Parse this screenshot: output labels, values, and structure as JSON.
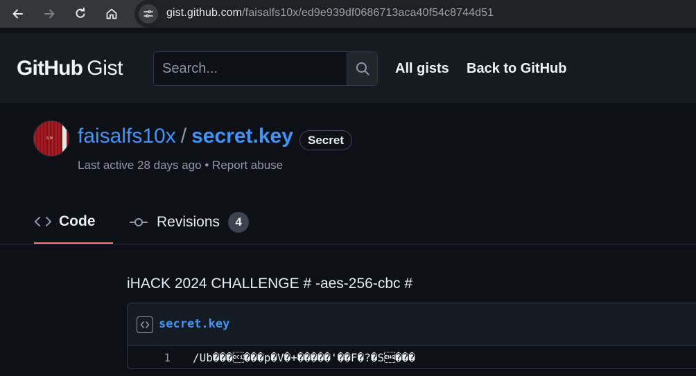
{
  "browser": {
    "url_host": "gist.github.com",
    "url_path": "/faisalfs10x/ed9e939df0686713aca40f54c8744d51",
    "back_icon": "arrow-left-icon",
    "forward_icon": "arrow-right-icon",
    "reload_icon": "reload-icon",
    "home_icon": "home-icon",
    "site_info_icon": "tune-icon"
  },
  "header": {
    "logo_github": "GitHub",
    "logo_gist": "Gist",
    "search_placeholder": "Search...",
    "search_icon": "search-icon",
    "links": [
      "All gists",
      "Back to GitHub"
    ]
  },
  "gist": {
    "owner": "faisalfs10x",
    "separator": "/",
    "file_title": "secret.key",
    "visibility_badge": "Secret",
    "last_active": "Last active 28 days ago",
    "meta_separator": "•",
    "report": "Report abuse",
    "avatar_text": "S M"
  },
  "tabs": [
    {
      "label": "Code",
      "icon": "code-icon",
      "selected": true
    },
    {
      "label": "Revisions",
      "icon": "commit-icon",
      "count": "4",
      "selected": false
    }
  ],
  "content": {
    "description": "iHACK 2024 CHALLENGE # -aes-256-cbc #",
    "file": {
      "name": "secret.key",
      "icon": "code-square-icon",
      "lines": [
        {
          "number": "1",
          "code": "/Ub���\u0011���p�V�+�����'��F�?�S\u0005���"
        }
      ]
    }
  },
  "colors": {
    "accent_link": "#4493f8",
    "tab_underline": "#f78166",
    "background": "#0d1117",
    "header_bg": "#161b22"
  }
}
